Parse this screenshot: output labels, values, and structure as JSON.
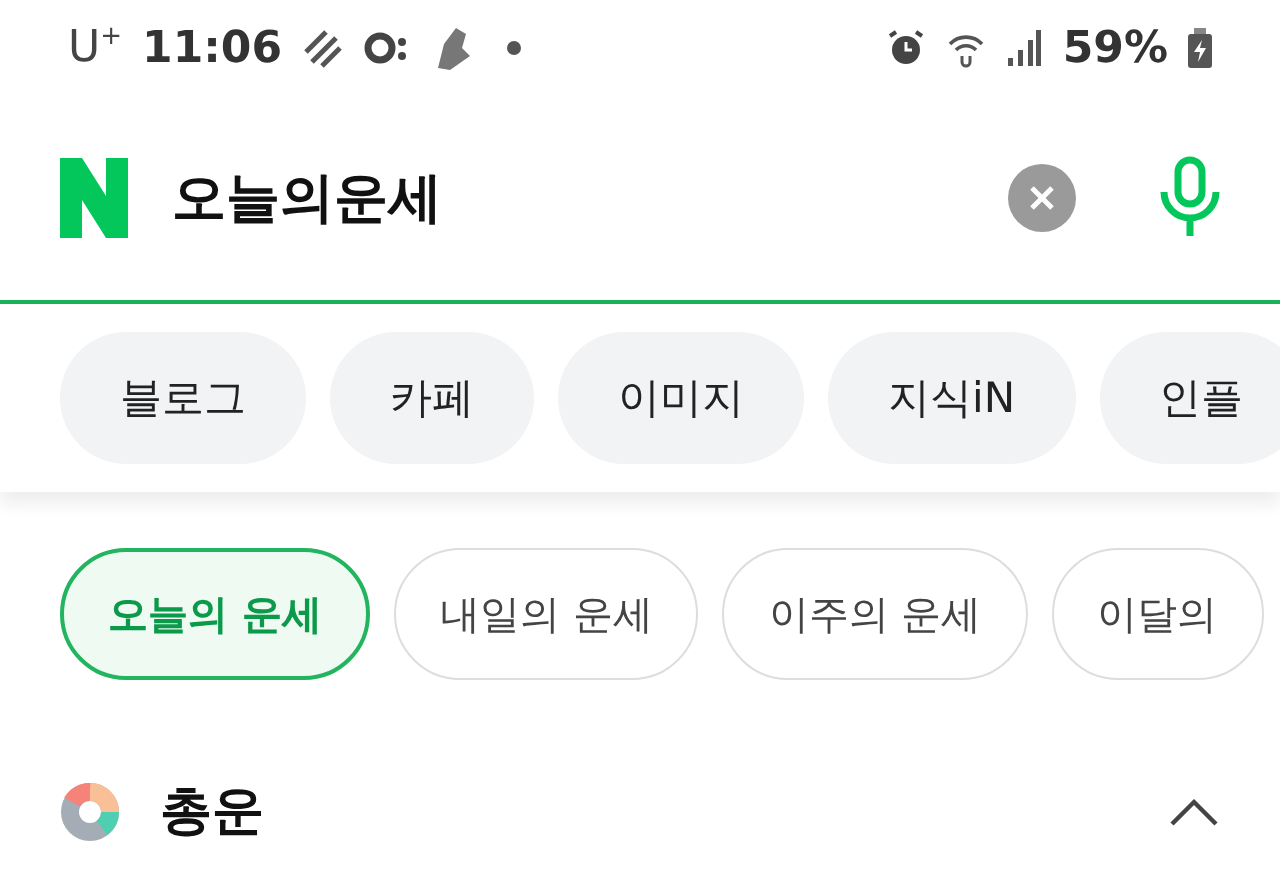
{
  "status_bar": {
    "carrier": "U",
    "carrier_sup": "+",
    "time": "11:06",
    "battery": "59%"
  },
  "search": {
    "value": "오늘의운세"
  },
  "tabs": [
    {
      "label": "블로그",
      "selected": false
    },
    {
      "label": "카페",
      "selected": false
    },
    {
      "label": "이미지",
      "selected": false
    },
    {
      "label": "지식iN",
      "selected": false
    },
    {
      "label": "인플",
      "selected": false
    }
  ],
  "fortune_tabs": [
    {
      "label": "오늘의 운세",
      "selected": true
    },
    {
      "label": "내일의 운세",
      "selected": false
    },
    {
      "label": "이주의 운세",
      "selected": false
    },
    {
      "label": "이달의",
      "selected": false
    }
  ],
  "section": {
    "title": "총운",
    "expanded": true
  }
}
